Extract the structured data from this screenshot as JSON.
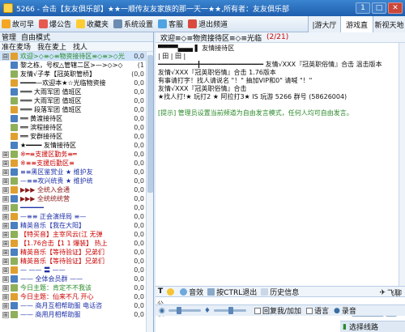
{
  "titlebar": {
    "title": "5266 - 合击【友友俱乐部】★★一顺传友友家族的那一天一★★,所有者：友友俱乐部",
    "btn_a": "1",
    "btn_b": "□",
    "btn_c": "✕"
  },
  "toolbar": {
    "items": [
      "故可早",
      "爆公告",
      "收藏夹",
      "系统设置",
      "客服",
      "退出频道"
    ],
    "tabs": [
      "|游大厅",
      "游戏直",
      "新视天地"
    ]
  },
  "left": {
    "header": [
      "管理",
      "自由模式"
    ],
    "sub": [
      "准在麦场",
      "我在麦上",
      "找人"
    ],
    "rows": [
      {
        "t": "欢迎>◇≡◇≡物资接待区≡◇≡>◇光临",
        "c": "0,0",
        "tw": "⊟",
        "color": "#2a8a2a",
        "sel": true
      },
      {
        "t": "黎之栋，号权△管辖二区>—>◇>◇",
        "c": "(1",
        "tw": "",
        "color": "#000"
      },
      {
        "t": "友情√子孝【冠英职管桥】",
        "c": "(0,0",
        "tw": "",
        "color": "#000"
      },
      {
        "t": "━━━━—欢迎本★☆光临物资接",
        "c": "0,0",
        "tw": "",
        "color": "#000"
      },
      {
        "t": "═══  大雨军团  值班区",
        "c": "0,0",
        "tw": "",
        "color": "#000"
      },
      {
        "t": "═══  大雨军团  值班区",
        "c": "0,0",
        "tw": "",
        "color": "#000"
      },
      {
        "t": "═══  段落军团  值班区",
        "c": "0,0",
        "tw": "",
        "color": "#000"
      },
      {
        "t": "══  黄渡接待区",
        "c": "0,0",
        "tw": "",
        "color": "#000"
      },
      {
        "t": "══  滨程接待区",
        "c": "0,0",
        "tw": "",
        "color": "#000"
      },
      {
        "t": "══  安群接待区",
        "c": "0,0",
        "tw": "",
        "color": "#000"
      },
      {
        "t": "★━━━━ 友情接待区",
        "c": "0,0",
        "tw": "",
        "color": "#000"
      },
      {
        "t": "※═≡支援区勤务≡═",
        "c": "0,0",
        "tw": "⊞",
        "color": "#c00"
      },
      {
        "t": "※≡≡支援后勤区≡",
        "c": "0,0",
        "tw": "⊞",
        "color": "#c00"
      },
      {
        "t": "≡≡黑区鉴赏业  ★ 维护友",
        "c": "0,0",
        "tw": "⊞",
        "color": "#1c2fa8"
      },
      {
        "t": "—≡≡攻兴统贵 ★ 维护统",
        "c": "0,0",
        "tw": "⊞",
        "color": "#1c2fa8"
      },
      {
        "t": "▶▶▶ 全统入会通",
        "c": "0,0",
        "tw": "⊞",
        "color": "#8b1a1a"
      },
      {
        "t": "▶▶▶ 全统统统营",
        "c": "0,0",
        "tw": "⊞",
        "color": "#8b1a1a"
      },
      {
        "t": "━━━━━━",
        "c": "0,0",
        "tw": "⊞",
        "color": "#1c2fa8"
      },
      {
        "t": "—≡≡ 正会演绎局 ≡—",
        "c": "0,0",
        "tw": "⊞",
        "color": "#1c2fa8"
      },
      {
        "t": "精英音乐【我在大阳】",
        "c": "0,0",
        "tw": "⊞",
        "color": "#1c2fa8"
      },
      {
        "t": "【特买音】主宰风云(江  无弹",
        "c": "0,0",
        "tw": "⊞",
        "color": "#c00"
      },
      {
        "t": "【1.76合击【1 1 爆装】 热上",
        "c": "0,0",
        "tw": "⊞",
        "color": "#c00"
      },
      {
        "t": "精英音乐【等待验证】兄弟们",
        "c": "0,0",
        "tw": "⊞",
        "color": "#c00"
      },
      {
        "t": "精英音乐【等待验证】兄弟们",
        "c": "0,0",
        "tw": "⊞",
        "color": "#c00"
      },
      {
        "t": "— —— 〓 ——",
        "c": "0,0",
        "tw": "⊞",
        "color": "#1c2fa8"
      },
      {
        "t": "—— 全体会员群 ——",
        "c": "0,0",
        "tw": "⊞",
        "color": "#1c2fa8"
      },
      {
        "t": "今日主题：肯定不不我该",
        "c": "0,0",
        "tw": "⊞",
        "color": "#2a8a2a"
      },
      {
        "t": "今日主题：仙来不凡  开心",
        "c": "0,0",
        "tw": "⊞",
        "color": "#c00"
      },
      {
        "t": "—— 商月互相帮助服  电话咨",
        "c": "0,0",
        "tw": "⊞",
        "color": "#1c2fa8"
      },
      {
        "t": "—— 商用月相帮助服",
        "c": "0,0",
        "tw": "⊞",
        "color": "#1c2fa8"
      }
    ]
  },
  "chat": {
    "room": "欢迎≡◇≡物资接待区≡◇≡光临",
    "count": "(2/21)",
    "messages": [
      {
        "t": "           ▀▀▀▀▄▄▄      ▌ 友情接待区",
        "c": ""
      },
      {
        "t": "  | 田 | 田 |",
        "c": ""
      },
      {
        "t": "  ━━━━━━━━━━╋━━━━━━━━━━━━━━━━ 友情√XXX『冠英职俗情』合击  温击版本",
        "c": ""
      },
      {
        "t": "友情√XXX『冠英职俗情』合击  1.76版本",
        "c": ""
      },
      {
        "t": "  有事请打字！找人请说名 \"！\" 抽加VIP和0\" 请喊 \"！\"",
        "c": ""
      },
      {
        "t": "    友情√XXX『冠英职俗情』合击",
        "c": ""
      },
      {
        "t": "      ★找人打!★ 玩打2 ★ 阿拉打3★  IS  玩游  5266   群号 (58626004)",
        "c": ""
      },
      {
        "t": "",
        "c": ""
      },
      {
        "t": "[提示]  管理员设置当前频道为自由发言模式，任何人均可自由发言。",
        "c": "green"
      }
    ]
  },
  "inputbar": {
    "items": [
      "音效",
      "按CTRL退出",
      "历史信息"
    ],
    "right": "飞聊"
  },
  "compose": {
    "to_label": "公",
    "priv_label": "私",
    "send": "发送",
    "dropdown": "▾"
  },
  "status": {
    "chk1": "回复我/加加",
    "chk2": "语言",
    "rec": "录音",
    "bottom": "选择线路"
  }
}
